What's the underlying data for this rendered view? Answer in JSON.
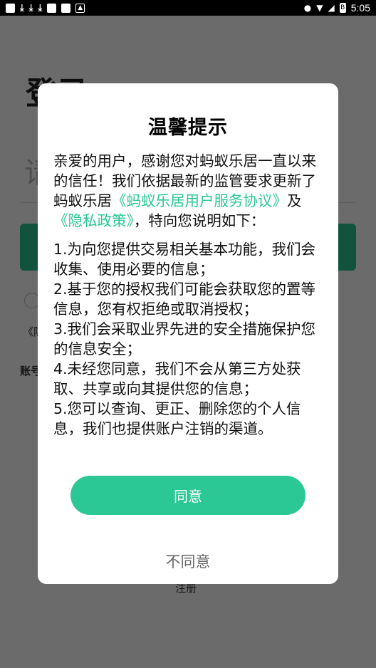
{
  "status_bar": {
    "time": "5:05",
    "battery_label": "B"
  },
  "background": {
    "title": "登录",
    "field_hint": "请",
    "privacy_link": "《隐",
    "account_label": "账号",
    "register_label": "注册"
  },
  "dialog": {
    "title": "温馨提示",
    "intro_part1": "亲爱的用户，感谢您对蚂蚁乐居一直以来的信任！我们依据最新的监管要求更新了蚂蚁乐居",
    "user_agreement_link": "《蚂蚁乐居用户服务协议》",
    "and_text": "及",
    "privacy_policy_link": "《隐私政策》",
    "intro_part2": "，特向您说明如下：",
    "points": [
      "1.为向您提供交易相关基本功能，我们会收集、使用必要的信息；",
      "2.基于您的授权我们可能会获取您的置等信息，您有权拒绝或取消授权；",
      "3.我们会采取业界先进的安全措施保护您的信息安全；",
      "4.未经您同意，我们不会从第三方处获取、共享或向其提供您的信息；",
      "5.您可以查询、更正、删除您的个人信息，我们也提供账户注销的渠道。"
    ],
    "agree_label": "同意",
    "disagree_label": "不同意"
  },
  "colors": {
    "accent": "#2bc795",
    "overlay": "rgba(0,0,0,0.58)"
  }
}
